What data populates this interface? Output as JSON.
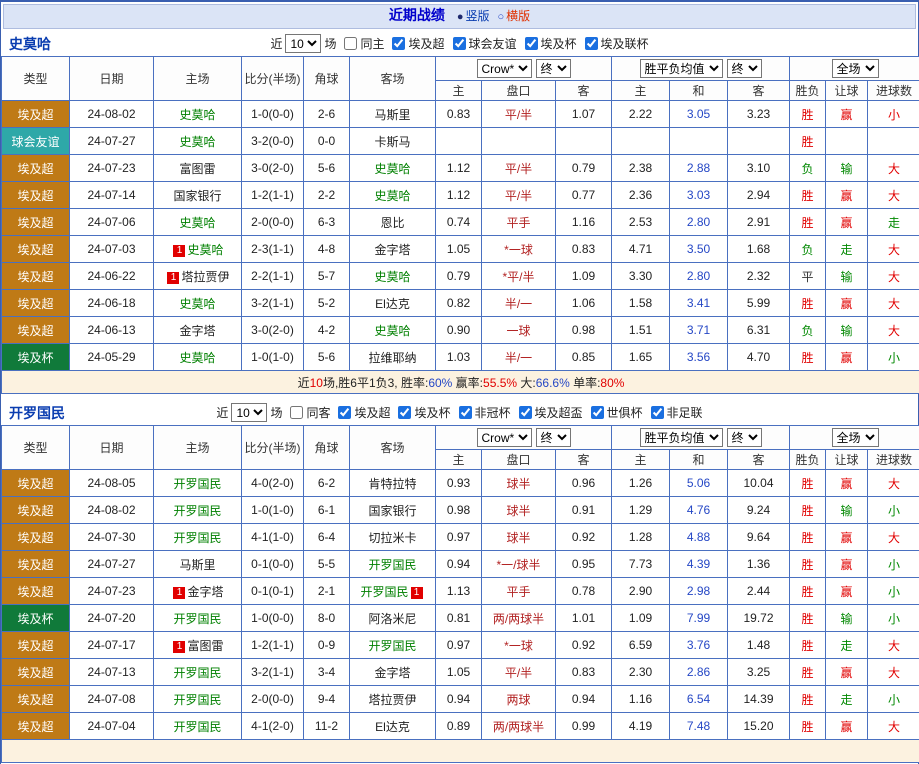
{
  "topbar": {
    "title": "近期战绩",
    "radio_vertical": "竖版",
    "radio_horizontal": "横版"
  },
  "table_headers": {
    "type": "类型",
    "date": "日期",
    "home": "主场",
    "score": "比分(半场)",
    "corner": "角球",
    "away": "客场",
    "odds_company": "Crow*",
    "final1": "终",
    "odds_cols": [
      "主",
      "盘口",
      "客"
    ],
    "wdl_label": "胜平负均值",
    "final2": "终",
    "wdl_cols": [
      "主",
      "和",
      "客"
    ],
    "scope_label": "全场",
    "result_cols": [
      "胜负",
      "让球",
      "进球数"
    ]
  },
  "colors": {
    "league_super": "#bf7a16",
    "league_friendly": "#2ea8a8",
    "league_cup": "#107a3a",
    "team_highlight": "#008000",
    "win_red": "#e10000",
    "lose_green": "#008800",
    "draw_blue": "#2547c5",
    "handicap_red": "#b22222"
  },
  "sections": [
    {
      "team": "史莫哈",
      "filter": {
        "near": "近",
        "count": "10",
        "games": "场",
        "same": "同主",
        "leagues": [
          "埃及超",
          "球会友谊",
          "埃及杯",
          "埃及联杯"
        ]
      },
      "rows": [
        {
          "type": "埃及超",
          "tc": "super",
          "date": "24-08-02",
          "home": "史莫哈",
          "hg": true,
          "score": "1-0(0-0)",
          "corner": "2-6",
          "away": "马斯里",
          "ag": false,
          "oh": "0.83",
          "hc": "平/半",
          "oa": "1.07",
          "wh": "2.22",
          "wd": "3.05",
          "wa": "3.23",
          "res": "胜",
          "resc": "r",
          "hr": "赢",
          "hrc": "r",
          "gr": "小",
          "grc": "r"
        },
        {
          "type": "球会友谊",
          "tc": "friendly",
          "date": "24-07-27",
          "home": "史莫哈",
          "hg": true,
          "score": "3-2(0-0)",
          "corner": "0-0",
          "away": "卡斯马",
          "ag": false,
          "oh": "",
          "hc": "",
          "oa": "",
          "wh": "",
          "wd": "",
          "wa": "",
          "res": "胜",
          "resc": "r",
          "hr": "",
          "hrc": "",
          "gr": "",
          "grc": ""
        },
        {
          "type": "埃及超",
          "tc": "super",
          "date": "24-07-23",
          "home": "富图雷",
          "hg": false,
          "score": "3-0(2-0)",
          "corner": "5-6",
          "away": "史莫哈",
          "ag": true,
          "oh": "1.12",
          "hc": "平/半",
          "oa": "0.79",
          "wh": "2.38",
          "wd": "2.88",
          "wa": "3.10",
          "res": "负",
          "resc": "g",
          "hr": "输",
          "hrc": "g",
          "gr": "大",
          "grc": "r"
        },
        {
          "type": "埃及超",
          "tc": "super",
          "date": "24-07-14",
          "home": "国家银行",
          "hg": false,
          "score": "1-2(1-1)",
          "corner": "2-2",
          "away": "史莫哈",
          "ag": true,
          "oh": "1.12",
          "hc": "平/半",
          "oa": "0.77",
          "wh": "2.36",
          "wd": "3.03",
          "wa": "2.94",
          "res": "胜",
          "resc": "r",
          "hr": "赢",
          "hrc": "r",
          "gr": "大",
          "grc": "r"
        },
        {
          "type": "埃及超",
          "tc": "super",
          "date": "24-07-06",
          "home": "史莫哈",
          "hg": true,
          "score": "2-0(0-0)",
          "corner": "6-3",
          "away": "恩比",
          "ag": false,
          "oh": "0.74",
          "hc": "平手",
          "oa": "1.16",
          "wh": "2.53",
          "wd": "2.80",
          "wa": "2.91",
          "res": "胜",
          "resc": "r",
          "hr": "赢",
          "hrc": "r",
          "gr": "走",
          "grc": "g"
        },
        {
          "type": "埃及超",
          "tc": "super",
          "date": "24-07-03",
          "hb": "1",
          "home": "史莫哈",
          "hg": true,
          "score": "2-3(1-1)",
          "corner": "4-8",
          "away": "金字塔",
          "ag": false,
          "oh": "1.05",
          "hc": "*一球",
          "oa": "0.83",
          "wh": "4.71",
          "wd": "3.50",
          "wa": "1.68",
          "res": "负",
          "resc": "g",
          "hr": "走",
          "hrc": "g",
          "gr": "大",
          "grc": "r"
        },
        {
          "type": "埃及超",
          "tc": "super",
          "date": "24-06-22",
          "hb": "1",
          "home": "塔拉贾伊",
          "hg": false,
          "score": "2-2(1-1)",
          "corner": "5-7",
          "away": "史莫哈",
          "ag": true,
          "oh": "0.79",
          "hc": "*平/半",
          "oa": "1.09",
          "wh": "3.30",
          "wd": "2.80",
          "wa": "2.32",
          "res": "平",
          "resc": "k",
          "hr": "输",
          "hrc": "g",
          "gr": "大",
          "grc": "r"
        },
        {
          "type": "埃及超",
          "tc": "super",
          "date": "24-06-18",
          "home": "史莫哈",
          "hg": true,
          "score": "3-2(1-1)",
          "corner": "5-2",
          "away": "El达克",
          "ag": false,
          "oh": "0.82",
          "hc": "半/一",
          "oa": "1.06",
          "wh": "1.58",
          "wd": "3.41",
          "wa": "5.99",
          "res": "胜",
          "resc": "r",
          "hr": "赢",
          "hrc": "r",
          "gr": "大",
          "grc": "r"
        },
        {
          "type": "埃及超",
          "tc": "super",
          "date": "24-06-13",
          "home": "金字塔",
          "hg": false,
          "score": "3-0(2-0)",
          "corner": "4-2",
          "away": "史莫哈",
          "ag": true,
          "oh": "0.90",
          "hc": "一球",
          "oa": "0.98",
          "wh": "1.51",
          "wd": "3.71",
          "wa": "6.31",
          "res": "负",
          "resc": "g",
          "hr": "输",
          "hrc": "g",
          "gr": "大",
          "grc": "r"
        },
        {
          "type": "埃及杯",
          "tc": "cup",
          "date": "24-05-29",
          "home": "史莫哈",
          "hg": true,
          "score": "1-0(1-0)",
          "corner": "5-6",
          "away": "拉维耶纳",
          "ag": false,
          "oh": "1.03",
          "hc": "半/一",
          "oa": "0.85",
          "wh": "1.65",
          "wd": "3.56",
          "wa": "4.70",
          "res": "胜",
          "resc": "r",
          "hr": "赢",
          "hrc": "r",
          "gr": "小",
          "grc": "g"
        }
      ],
      "summary": [
        {
          "t": "近"
        },
        {
          "t": "10",
          "c": "r"
        },
        {
          "t": "场,胜6平1负3, 胜率:"
        },
        {
          "t": "60%",
          "c": "b"
        },
        {
          "t": " 赢率:"
        },
        {
          "t": "55.5%",
          "c": "r"
        },
        {
          "t": " 大:"
        },
        {
          "t": "66.6%",
          "c": "b"
        },
        {
          "t": " 单率:"
        },
        {
          "t": "80%",
          "c": "r"
        }
      ]
    },
    {
      "team": "开罗国民",
      "filter": {
        "near": "近",
        "count": "10",
        "games": "场",
        "same": "同客",
        "leagues": [
          "埃及超",
          "埃及杯",
          "非冠杯",
          "埃及超盃",
          "世俱杯",
          "非足联"
        ]
      },
      "rows": [
        {
          "type": "埃及超",
          "tc": "super",
          "date": "24-08-05",
          "home": "开罗国民",
          "hg": true,
          "score": "4-0(2-0)",
          "corner": "6-2",
          "away": "肯特拉特",
          "ag": false,
          "oh": "0.93",
          "hc": "球半",
          "oa": "0.96",
          "wh": "1.26",
          "wd": "5.06",
          "wa": "10.04",
          "res": "胜",
          "resc": "r",
          "hr": "赢",
          "hrc": "r",
          "gr": "大",
          "grc": "r"
        },
        {
          "type": "埃及超",
          "tc": "super",
          "date": "24-08-02",
          "home": "开罗国民",
          "hg": true,
          "score": "1-0(1-0)",
          "corner": "6-1",
          "away": "国家银行",
          "ag": false,
          "oh": "0.98",
          "hc": "球半",
          "oa": "0.91",
          "wh": "1.29",
          "wd": "4.76",
          "wa": "9.24",
          "res": "胜",
          "resc": "r",
          "hr": "输",
          "hrc": "g",
          "gr": "小",
          "grc": "g"
        },
        {
          "type": "埃及超",
          "tc": "super",
          "date": "24-07-30",
          "home": "开罗国民",
          "hg": true,
          "score": "4-1(1-0)",
          "corner": "6-4",
          "away": "切拉米卡",
          "ag": false,
          "oh": "0.97",
          "hc": "球半",
          "oa": "0.92",
          "wh": "1.28",
          "wd": "4.88",
          "wa": "9.64",
          "res": "胜",
          "resc": "r",
          "hr": "赢",
          "hrc": "r",
          "gr": "大",
          "grc": "r"
        },
        {
          "type": "埃及超",
          "tc": "super",
          "date": "24-07-27",
          "home": "马斯里",
          "hg": false,
          "score": "0-1(0-0)",
          "corner": "5-5",
          "away": "开罗国民",
          "ag": true,
          "oh": "0.94",
          "hc": "*一/球半",
          "oa": "0.95",
          "wh": "7.73",
          "wd": "4.39",
          "wa": "1.36",
          "res": "胜",
          "resc": "r",
          "hr": "赢",
          "hrc": "r",
          "gr": "小",
          "grc": "g"
        },
        {
          "type": "埃及超",
          "tc": "super",
          "date": "24-07-23",
          "hb": "1",
          "home": "金字塔",
          "hg": false,
          "score": "0-1(0-1)",
          "corner": "2-1",
          "away": "开罗国民",
          "ag": true,
          "aba": "1",
          "oh": "1.13",
          "hc": "平手",
          "oa": "0.78",
          "wh": "2.90",
          "wd": "2.98",
          "wa": "2.44",
          "res": "胜",
          "resc": "r",
          "hr": "赢",
          "hrc": "r",
          "gr": "小",
          "grc": "g"
        },
        {
          "type": "埃及杯",
          "tc": "cup",
          "date": "24-07-20",
          "home": "开罗国民",
          "hg": true,
          "score": "1-0(0-0)",
          "corner": "8-0",
          "away": "阿洛米尼",
          "ag": false,
          "oh": "0.81",
          "hc": "两/两球半",
          "oa": "1.01",
          "wh": "1.09",
          "wd": "7.99",
          "wa": "19.72",
          "res": "胜",
          "resc": "r",
          "hr": "输",
          "hrc": "g",
          "gr": "小",
          "grc": "g"
        },
        {
          "type": "埃及超",
          "tc": "super",
          "date": "24-07-17",
          "hb": "1",
          "home": "富图雷",
          "hg": false,
          "score": "1-2(1-1)",
          "corner": "0-9",
          "away": "开罗国民",
          "ag": true,
          "oh": "0.97",
          "hc": "*一球",
          "oa": "0.92",
          "wh": "6.59",
          "wd": "3.76",
          "wa": "1.48",
          "res": "胜",
          "resc": "r",
          "hr": "走",
          "hrc": "g",
          "gr": "大",
          "grc": "r"
        },
        {
          "type": "埃及超",
          "tc": "super",
          "date": "24-07-13",
          "home": "开罗国民",
          "hg": true,
          "score": "3-2(1-1)",
          "corner": "3-4",
          "away": "金字塔",
          "ag": false,
          "oh": "1.05",
          "hc": "平/半",
          "oa": "0.83",
          "wh": "2.30",
          "wd": "2.86",
          "wa": "3.25",
          "res": "胜",
          "resc": "r",
          "hr": "赢",
          "hrc": "r",
          "gr": "大",
          "grc": "r"
        },
        {
          "type": "埃及超",
          "tc": "super",
          "date": "24-07-08",
          "home": "开罗国民",
          "hg": true,
          "score": "2-0(0-0)",
          "corner": "9-4",
          "away": "塔拉贾伊",
          "ag": false,
          "oh": "0.94",
          "hc": "两球",
          "oa": "0.94",
          "wh": "1.16",
          "wd": "6.54",
          "wa": "14.39",
          "res": "胜",
          "resc": "r",
          "hr": "走",
          "hrc": "g",
          "gr": "小",
          "grc": "g"
        },
        {
          "type": "埃及超",
          "tc": "super",
          "date": "24-07-04",
          "home": "开罗国民",
          "hg": true,
          "score": "4-1(2-0)",
          "corner": "11-2",
          "away": "El达克",
          "ag": false,
          "oh": "0.89",
          "hc": "两/两球半",
          "oa": "0.99",
          "wh": "4.19",
          "wd": "7.48",
          "wa": "15.20",
          "res": "胜",
          "resc": "r",
          "hr": "赢",
          "hrc": "r",
          "gr": "大",
          "grc": "r"
        }
      ],
      "summary": []
    }
  ]
}
